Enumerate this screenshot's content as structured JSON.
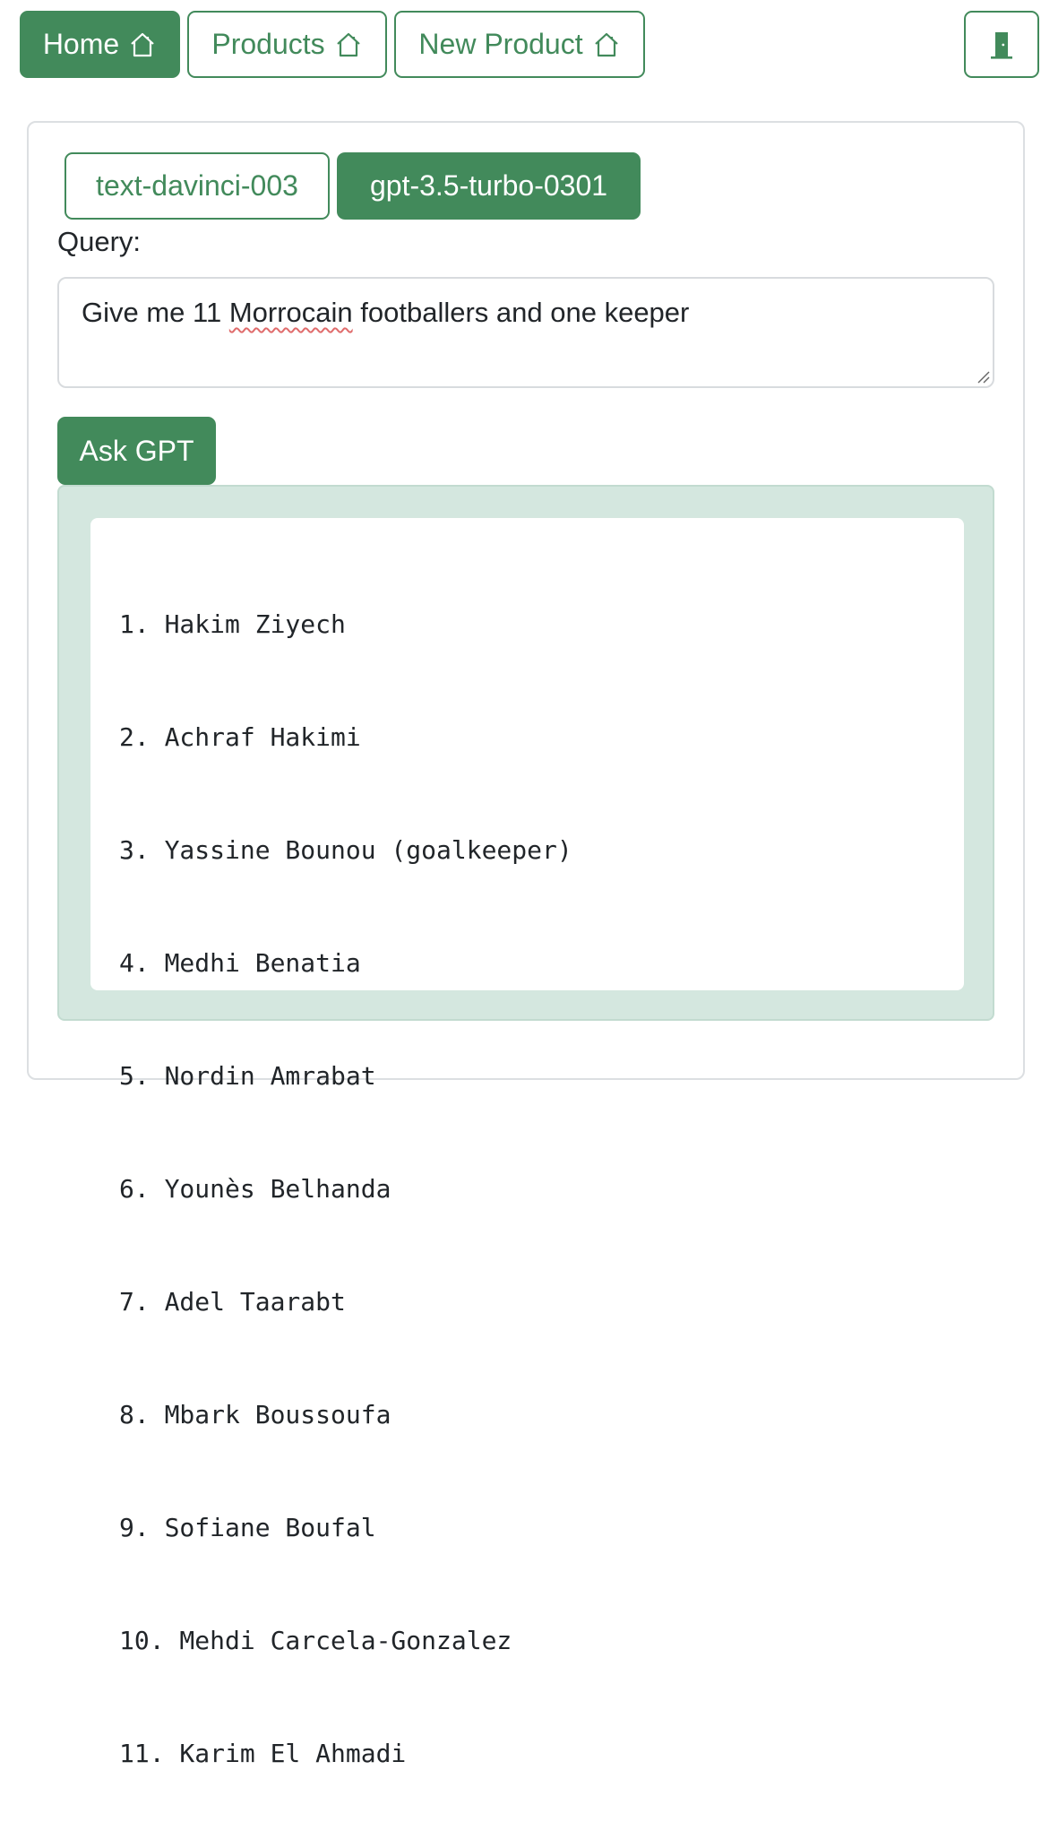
{
  "nav": {
    "home_label": "Home",
    "products_label": "Products",
    "new_product_label": "New Product",
    "icons": {
      "home": "house-icon",
      "exit": "door-exit-icon"
    }
  },
  "models": {
    "options": [
      "text-davinci-003",
      "gpt-3.5-turbo-0301"
    ],
    "selected": "gpt-3.5-turbo-0301"
  },
  "query": {
    "label": "Query:",
    "value_before": "Give me 11 ",
    "value_misspelled": "Morrocain",
    "value_after": " footballers and one keeper"
  },
  "ask_button_label": "Ask GPT",
  "response_lines": [
    "1. Hakim Ziyech",
    "2. Achraf Hakimi",
    "3. Yassine Bounou (goalkeeper)",
    "4. Medhi Benatia",
    "5. Nordin Amrabat",
    "6. Younès Belhanda",
    "7. Adel Taarabt",
    "8. Mbark Boussoufa",
    "9. Sofiane Boufal",
    "10. Mehdi Carcela-Gonzalez",
    "11. Karim El Ahmadi"
  ],
  "colors": {
    "accent": "#428a5b",
    "result_background": "#d4e7df"
  }
}
